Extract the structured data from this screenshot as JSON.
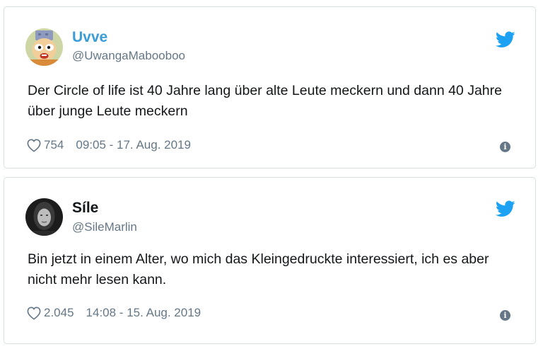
{
  "colors": {
    "name_tweet_0": "#3b9dd6",
    "name_tweet_1": "#14171a",
    "handle": "#657786",
    "text": "#14171a",
    "twitter_blue": "#1da1f2",
    "border": "#d8dfe4"
  },
  "tweets": [
    {
      "display_name": "Uvve",
      "handle": "@UwangaMabooboo",
      "text": "Der Circle of life ist 40 Jahre lang über alte Leute meckern und dann 40 Jahre über junge Leute meckern",
      "likes": "754",
      "timestamp": "09:05 - 17. Aug. 2019",
      "avatar_icon": "cartoon-character-avatar",
      "brand_icon": "twitter-bird-icon",
      "info_icon": "info-icon"
    },
    {
      "display_name": "Síle",
      "handle": "@SileMarlin",
      "text": "Bin jetzt in einem Alter, wo mich das Kleingedruckte interessiert, ich es aber nicht mehr lesen kann.",
      "likes": "2.045",
      "timestamp": "14:08 - 15. Aug. 2019",
      "avatar_icon": "photo-avatar",
      "brand_icon": "twitter-bird-icon",
      "info_icon": "info-icon"
    }
  ]
}
